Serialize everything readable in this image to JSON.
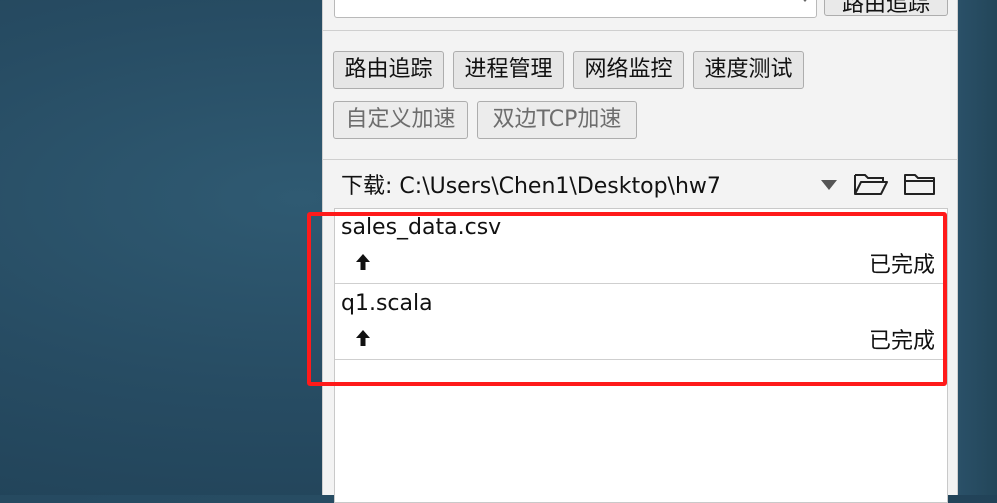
{
  "top": {
    "trace_button_label": "路由追踪"
  },
  "toolbar": {
    "buttons": [
      {
        "label": "路由追踪"
      },
      {
        "label": "进程管理"
      },
      {
        "label": "网络监控"
      },
      {
        "label": "速度测试"
      },
      {
        "label": "自定义加速"
      },
      {
        "label": "双边TCP加速"
      }
    ]
  },
  "download": {
    "label": "下载:",
    "path": "C:\\Users\\Chen1\\Desktop\\hw7"
  },
  "transfers": [
    {
      "filename": "sales_data.csv",
      "direction_icon": "upload-arrow-icon",
      "status": "已完成"
    },
    {
      "filename": "q1.scala",
      "direction_icon": "upload-arrow-icon",
      "status": "已完成"
    }
  ],
  "colors": {
    "highlight": "#ff1a1a",
    "panel_bg": "#f3f3f3",
    "desktop_bg": "#274c63"
  }
}
